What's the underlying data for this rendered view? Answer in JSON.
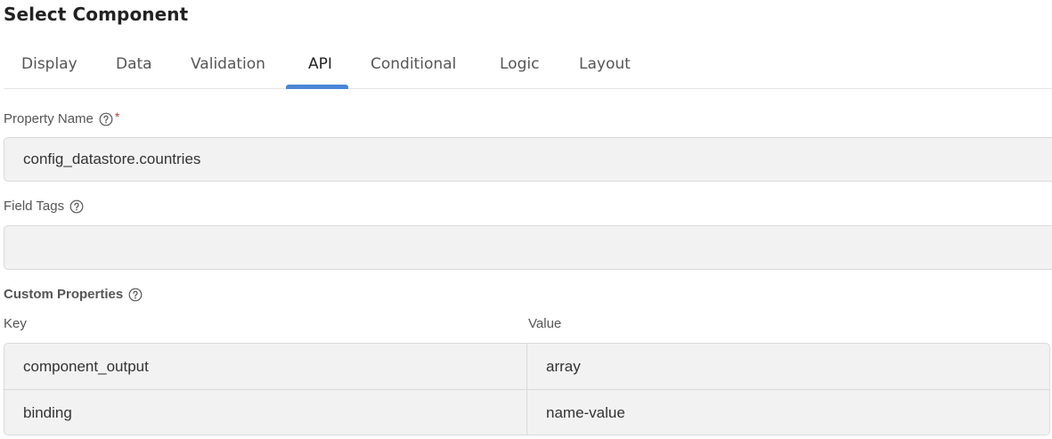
{
  "header": {
    "title": "Select Component"
  },
  "tabs": [
    {
      "label": "Display"
    },
    {
      "label": "Data"
    },
    {
      "label": "Validation"
    },
    {
      "label": "API"
    },
    {
      "label": "Conditional"
    },
    {
      "label": "Logic"
    },
    {
      "label": "Layout"
    }
  ],
  "active_tab": "API",
  "fields": {
    "property_name": {
      "label": "Property Name",
      "required_mark": "*",
      "value": "config_datastore.countries"
    },
    "field_tags": {
      "label": "Field Tags",
      "value": ""
    }
  },
  "custom_properties": {
    "label": "Custom Properties",
    "columns": {
      "key": "Key",
      "value": "Value"
    },
    "rows": [
      {
        "key": "component_output",
        "value": "array"
      },
      {
        "key": "binding",
        "value": "name-value"
      }
    ]
  },
  "colors": {
    "accent": "#4a86d6",
    "field_bg": "#f2f2f2",
    "required": "#c23a3a"
  },
  "icons": {
    "help": "question-circle-icon"
  }
}
